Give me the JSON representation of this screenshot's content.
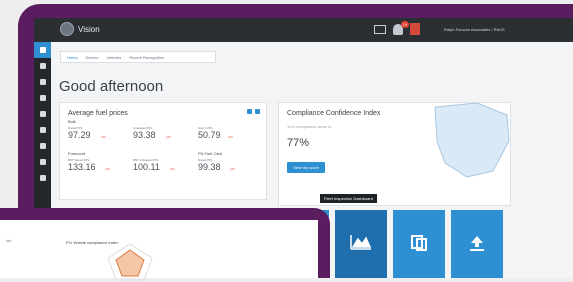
{
  "app": {
    "name": "Vision",
    "notification_count": "19",
    "user_text": "Ralph Funcom Associates / RAUS"
  },
  "tabs": [
    "Home",
    "Drivers",
    "Vehicles",
    "Recent Recognition"
  ],
  "greeting": "Good afternoon",
  "fuel_card": {
    "title": "Average fuel prices",
    "sections": [
      {
        "label": "Bulk",
        "items": [
          {
            "label": "Diesel PPL",
            "value": "97.29",
            "unit": "c/ltr"
          },
          {
            "label": "Unleaded PPL",
            "value": "93.38",
            "unit": "c/ltr"
          },
          {
            "label": "Gas in PPL",
            "value": "50.79",
            "unit": "c/ltr"
          }
        ]
      },
      {
        "label": "Forecourt",
        "card_label": "FN Fuel Card",
        "items": [
          {
            "label": "BST Diesel PPL",
            "value": "133.16",
            "unit": "c/ltr"
          },
          {
            "label": "BST Unleaded PPL",
            "value": "100.11",
            "unit": "c/ltr"
          },
          {
            "label": "Diesel PPL",
            "value": "99.38",
            "unit": "c/ltr"
          }
        ]
      }
    ]
  },
  "compliance_card": {
    "title": "Compliance Confidence Index",
    "subtitle": "Your compliance score is",
    "value": "77%",
    "button_label": "View my score"
  },
  "tooltip": "Fleet Inspection Dashboard",
  "tile_icons": [
    "area-chart-icon",
    "copy-icon",
    "upload-icon"
  ],
  "inset": {
    "left_label": "Idx",
    "chart_title": "F% Vehicle compliance index"
  },
  "colors": {
    "frame": "#5a1d5f",
    "accent": "#2f8fd3",
    "topbar": "#2b2f34",
    "sidebar": "#23272c",
    "price_unit": "#e2402f"
  }
}
